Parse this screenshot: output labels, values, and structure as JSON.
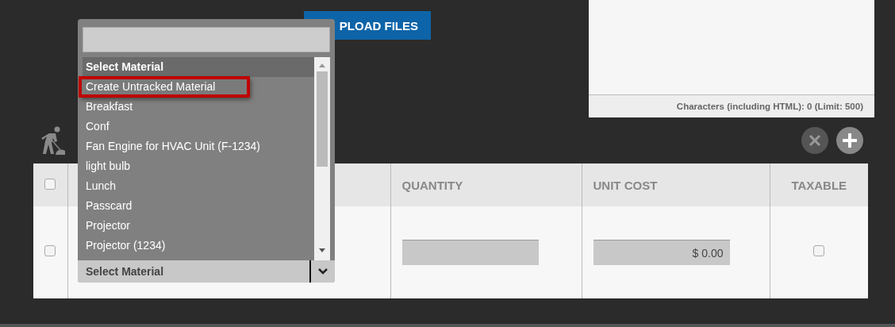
{
  "upload_button": {
    "label": "PLOAD FILES"
  },
  "notes": {
    "counter": "Characters (including HTML): 0 (Limit: 500)"
  },
  "table": {
    "header_checked": false,
    "columns": [
      "QUANTITY",
      "UNIT COST",
      "TAXABLE"
    ],
    "rows": [
      {
        "checked": false,
        "material": "Select Material",
        "unit_cost": "$ 0.00",
        "taxable": false
      }
    ]
  },
  "dropdown": {
    "options": [
      {
        "label": "Select Material",
        "kind": "header",
        "selected": false
      },
      {
        "label": "Create Untracked Material",
        "kind": "option",
        "selected": true
      },
      {
        "label": "Breakfast",
        "kind": "option",
        "selected": false
      },
      {
        "label": "Conf",
        "kind": "option",
        "selected": false
      },
      {
        "label": "Fan Engine for HVAC Unit (F-1234)",
        "kind": "option",
        "selected": false
      },
      {
        "label": "light bulb",
        "kind": "option",
        "selected": false
      },
      {
        "label": "Lunch",
        "kind": "option",
        "selected": false
      },
      {
        "label": "Passcard",
        "kind": "option",
        "selected": false
      },
      {
        "label": "Projector",
        "kind": "option",
        "selected": false
      },
      {
        "label": "Projector (1234)",
        "kind": "option",
        "selected": false
      }
    ]
  }
}
